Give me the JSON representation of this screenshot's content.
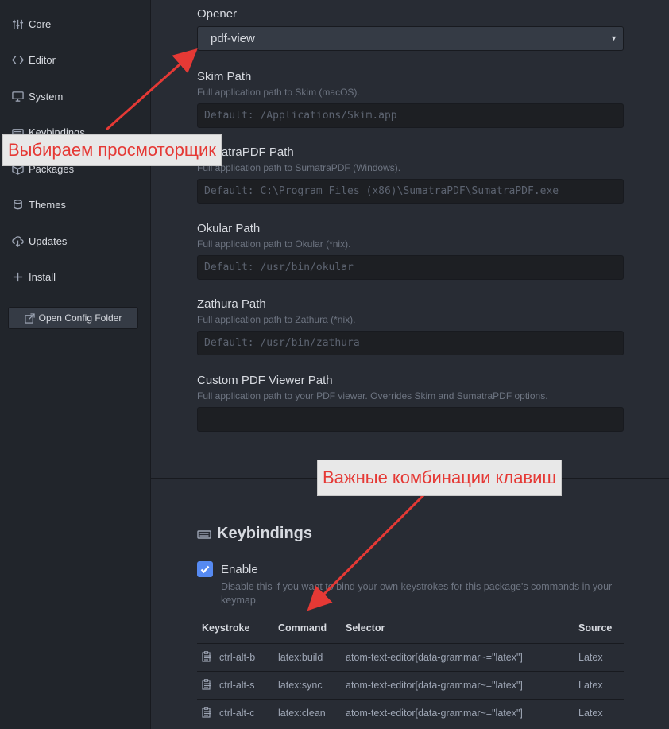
{
  "sidebar": {
    "items": [
      {
        "label": "Core",
        "icon": "sliders-icon"
      },
      {
        "label": "Editor",
        "icon": "code-icon"
      },
      {
        "label": "System",
        "icon": "monitor-icon"
      },
      {
        "label": "Keybindings",
        "icon": "keyboard-icon"
      },
      {
        "label": "Packages",
        "icon": "package-icon"
      },
      {
        "label": "Themes",
        "icon": "paintcan-icon"
      },
      {
        "label": "Updates",
        "icon": "cloud-download-icon"
      },
      {
        "label": "Install",
        "icon": "plus-icon"
      }
    ],
    "open_config_label": "Open Config Folder"
  },
  "settings": {
    "opener": {
      "label": "Opener",
      "value": "pdf-view"
    },
    "skim": {
      "label": "Skim Path",
      "desc": "Full application path to Skim (macOS).",
      "placeholder": "Default: /Applications/Skim.app"
    },
    "sumatra": {
      "label": "SumatraPDF Path",
      "desc": "Full application path to SumatraPDF (Windows).",
      "placeholder": "Default: C:\\Program Files (x86)\\SumatraPDF\\SumatraPDF.exe"
    },
    "okular": {
      "label": "Okular Path",
      "desc": "Full application path to Okular (*nix).",
      "placeholder": "Default: /usr/bin/okular"
    },
    "zathura": {
      "label": "Zathura Path",
      "desc": "Full application path to Zathura (*nix).",
      "placeholder": "Default: /usr/bin/zathura"
    },
    "custom": {
      "label": "Custom PDF Viewer Path",
      "desc": "Full application path to your PDF viewer. Overrides Skim and SumatraPDF options.",
      "placeholder": ""
    }
  },
  "keybindings": {
    "title": "Keybindings",
    "enable_label": "Enable",
    "enable_checked": true,
    "enable_desc": "Disable this if you want to bind your own keystrokes for this package's commands in your keymap.",
    "headers": {
      "keystroke": "Keystroke",
      "command": "Command",
      "selector": "Selector",
      "source": "Source"
    },
    "rows": [
      {
        "keystroke": "ctrl-alt-b",
        "command": "latex:build",
        "selector": "atom-text-editor[data-grammar~=\"latex\"]",
        "source": "Latex"
      },
      {
        "keystroke": "ctrl-alt-s",
        "command": "latex:sync",
        "selector": "atom-text-editor[data-grammar~=\"latex\"]",
        "source": "Latex"
      },
      {
        "keystroke": "ctrl-alt-c",
        "command": "latex:clean",
        "selector": "atom-text-editor[data-grammar~=\"latex\"]",
        "source": "Latex"
      }
    ]
  },
  "annotations": {
    "viewer": "Выбираем просмоторщик",
    "keys": "Важные комбинации клавиш",
    "color": "#e53935"
  }
}
